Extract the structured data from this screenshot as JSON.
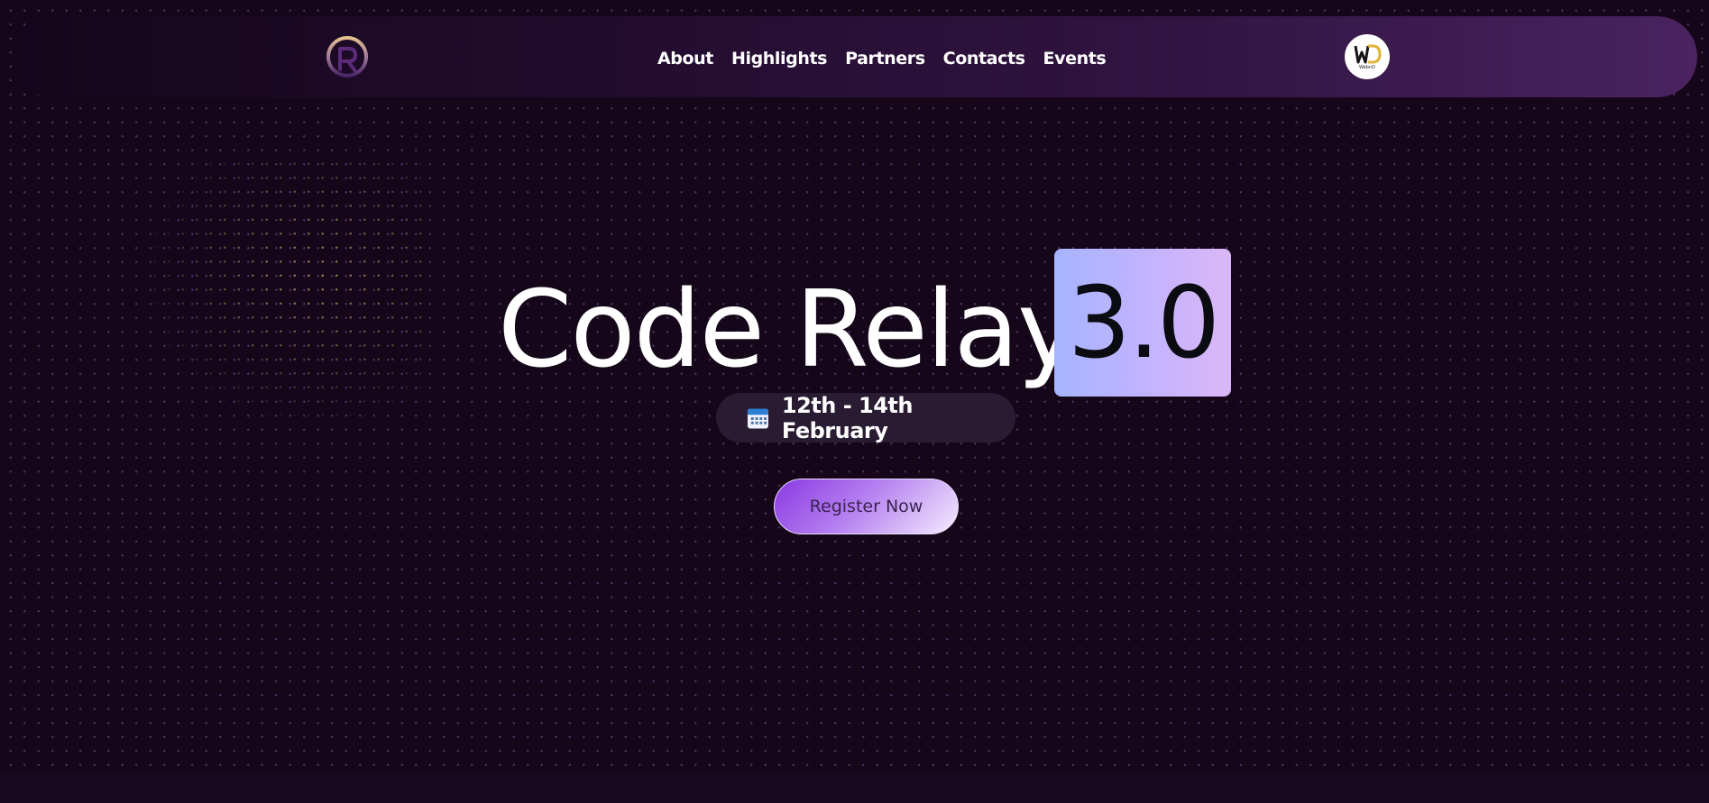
{
  "nav": {
    "logo_icon": "r-ring-logo-icon",
    "links": [
      "About",
      "Highlights",
      "Partners",
      "Contacts",
      "Events"
    ],
    "partner_logo_icon": "webnd-logo-icon",
    "partner_logo_text": "WebnD"
  },
  "hero": {
    "title": "Code Relay",
    "version": "3.0",
    "date_icon": "calendar-icon",
    "date": "12th - 14th February",
    "cta_label": "Register Now"
  },
  "colors": {
    "background": "#150719",
    "navbar_start": "#14061b",
    "navbar_end": "#4a2360",
    "version_gradient_start": "#a6b4ff",
    "version_gradient_end": "#dbb7f7",
    "cta_gradient_start": "#8a3ae2",
    "cta_gradient_end": "#f5ecff",
    "logo_gold": "#d9b58a",
    "logo_purple": "#5b2c7a"
  }
}
